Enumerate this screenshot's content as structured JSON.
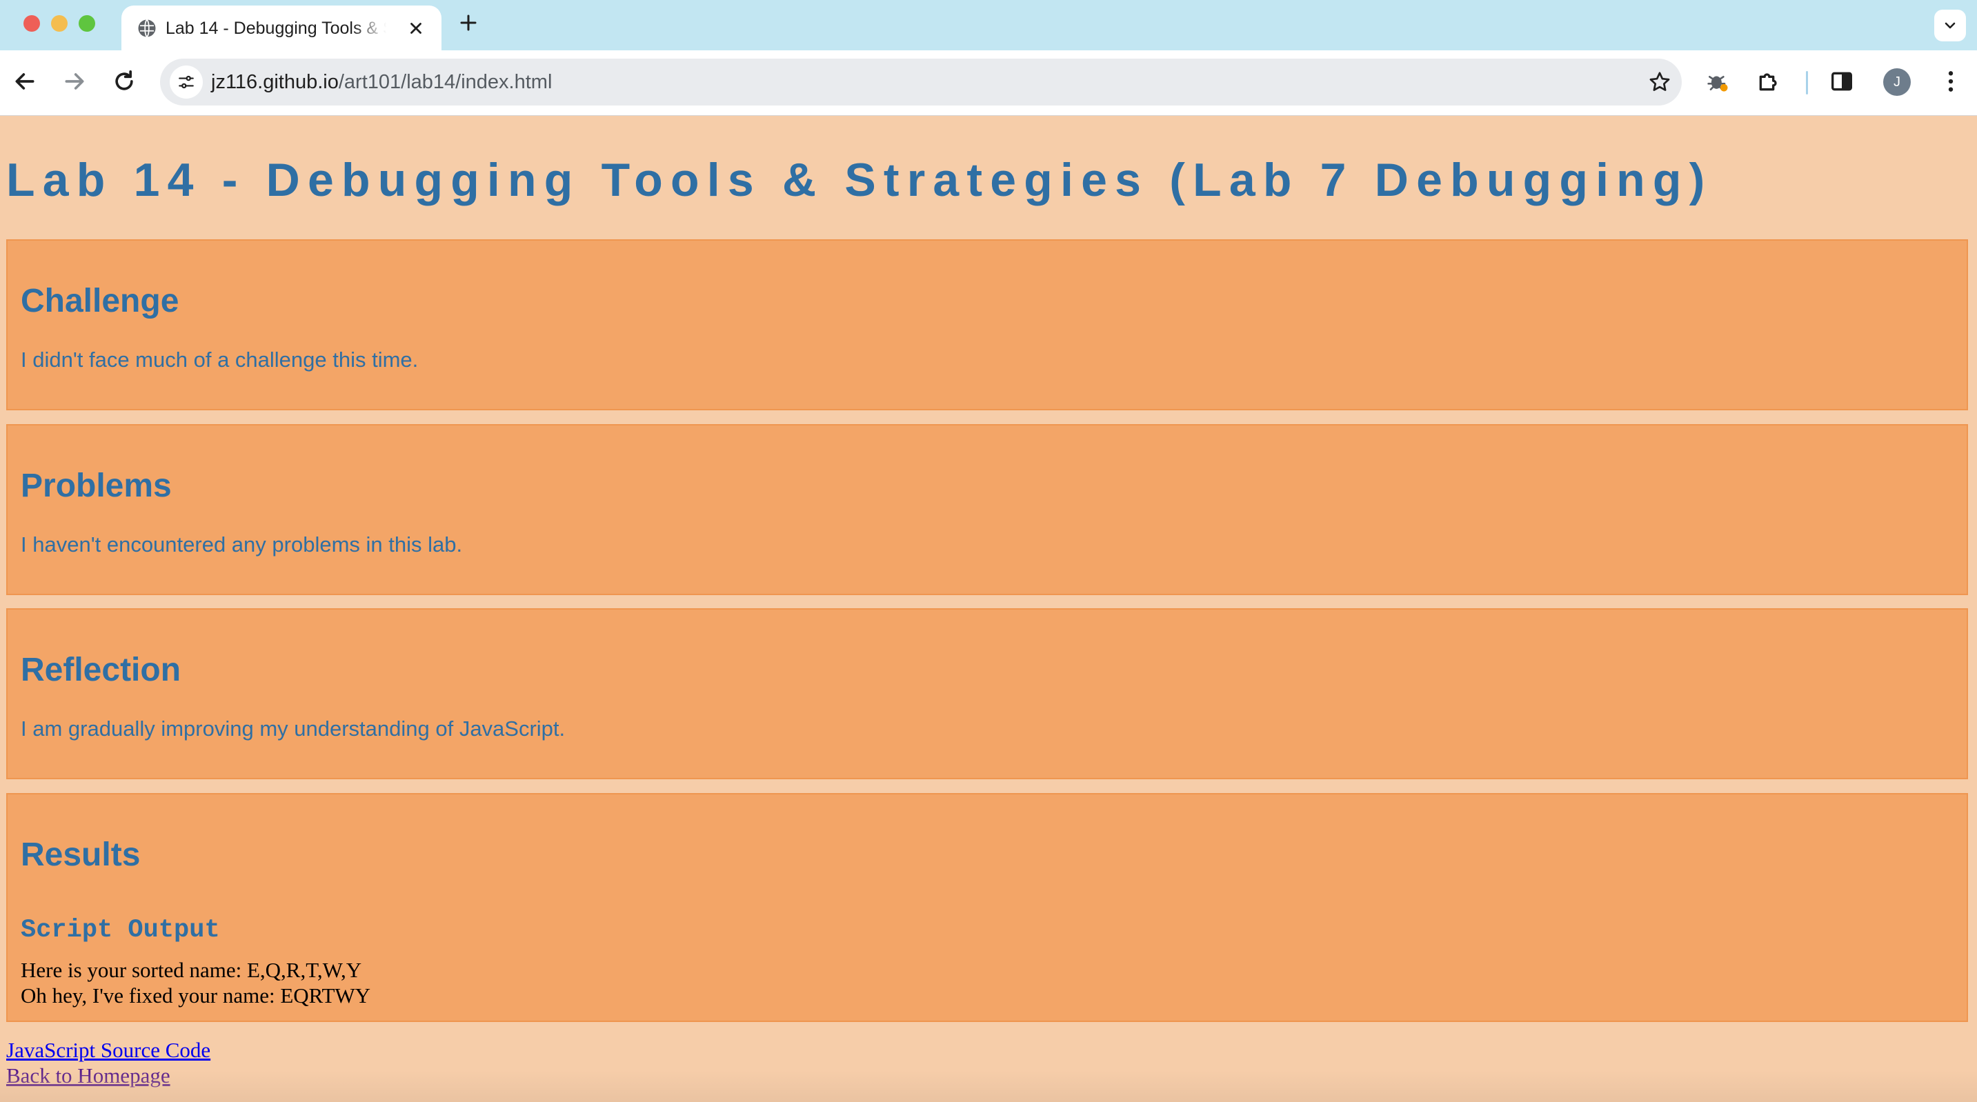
{
  "browser": {
    "tab_title": "Lab 14 - Debugging Tools & Strategies (Lab 7 Debugging)",
    "url_host": "jz116.github.io",
    "url_path": "/art101/lab14/index.html",
    "profile_initial": "J"
  },
  "page": {
    "title": "Lab 14 - Debugging Tools & Strategies (Lab 7 Debugging)",
    "sections": [
      {
        "heading": "Challenge",
        "text": "I didn't face much of a challenge this time."
      },
      {
        "heading": "Problems",
        "text": "I haven't encountered any problems in this lab."
      },
      {
        "heading": "Reflection",
        "text": "I am gradually improving my understanding of JavaScript."
      },
      {
        "heading": "Results",
        "subheading": "Script Output",
        "output_lines": [
          "Here is your sorted name: E,Q,R,T,W,Y",
          "Oh hey, I've fixed your name: EQRTWY"
        ]
      }
    ],
    "links": {
      "source_code": "JavaScript Source Code",
      "homepage": "Back to Homepage"
    }
  },
  "colors": {
    "page_background": "#f6cda9",
    "section_background": "#f3a567",
    "heading_text": "#2f6fa4",
    "link": "#0000ee",
    "visited_link": "#551a8b"
  }
}
